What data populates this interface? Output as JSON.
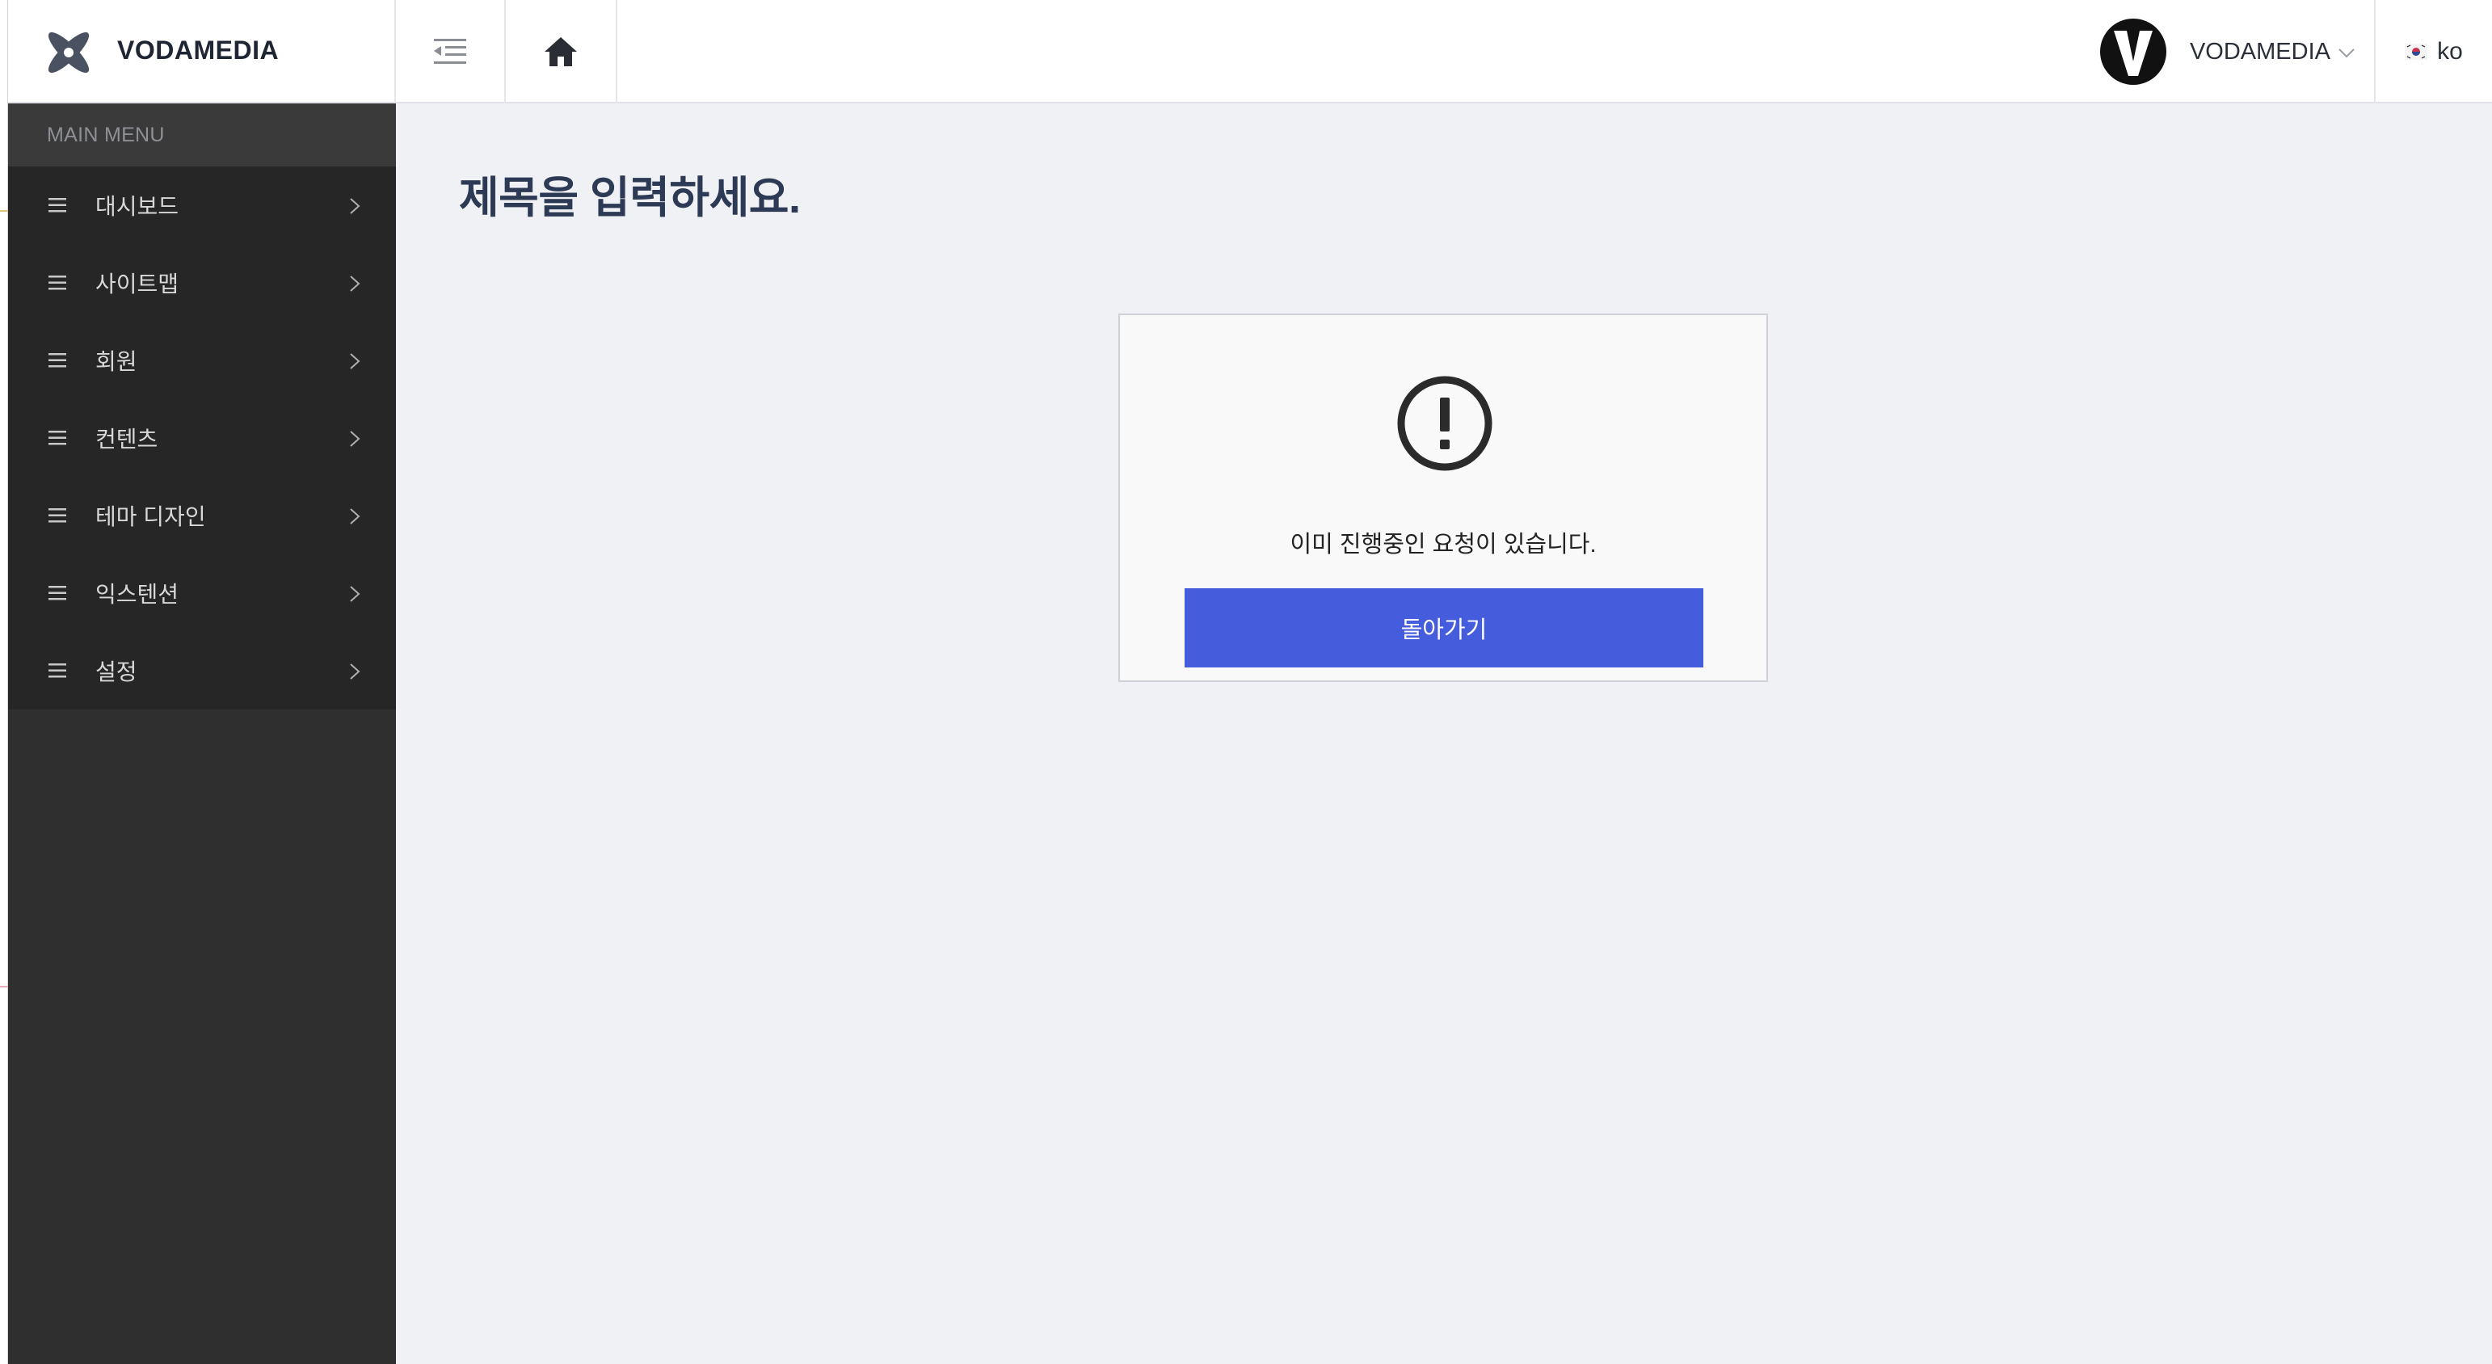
{
  "header": {
    "brand_name": "VODAMEDIA",
    "user_name": "VODAMEDIA",
    "language": "ko",
    "icons": [
      "menu-collapse-icon",
      "home-icon",
      "chevron-down-icon",
      "korea-flag-icon"
    ]
  },
  "sidebar": {
    "title": "MAIN MENU",
    "items": [
      {
        "label": "대시보드"
      },
      {
        "label": "사이트맵"
      },
      {
        "label": "회원"
      },
      {
        "label": "컨텐츠"
      },
      {
        "label": "테마 디자인"
      },
      {
        "label": "익스텐션"
      },
      {
        "label": "설정"
      }
    ]
  },
  "main": {
    "title": "제목을 입력하세요.",
    "alert": {
      "message": "이미 진행중인 요청이 있습니다.",
      "button_label": "돌아가기",
      "icon": "exclamation-circle-icon"
    }
  },
  "colors": {
    "primary_button": "#455ddc",
    "sidebar_bg": "#262626",
    "page_bg": "#f0f1f5",
    "title_color": "#2d3a55"
  }
}
